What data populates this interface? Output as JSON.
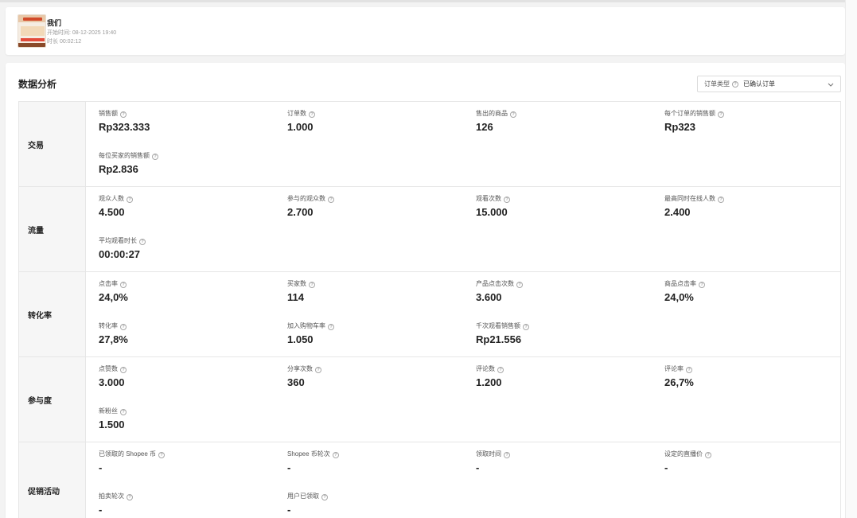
{
  "stream": {
    "title": "我们",
    "start_time": "开始时间: 08-12-2025 19:40",
    "duration": "时长 00:02:12"
  },
  "analysis": {
    "title": "数据分析",
    "order_type_label": "订单类型",
    "order_type_value": "已确认订单"
  },
  "sections": [
    {
      "name": "交易",
      "metrics": [
        {
          "label": "销售额",
          "value": "Rp323.333"
        },
        {
          "label": "订单数",
          "value": "1.000"
        },
        {
          "label": "售出的商品",
          "value": "126"
        },
        {
          "label": "每个订单的销售额",
          "value": "Rp323"
        },
        {
          "label": "每位买家的销售额",
          "value": "Rp2.836"
        }
      ]
    },
    {
      "name": "流量",
      "metrics": [
        {
          "label": "观众人数",
          "value": "4.500"
        },
        {
          "label": "参与的观众数",
          "value": "2.700"
        },
        {
          "label": "观看次数",
          "value": "15.000"
        },
        {
          "label": "最高同时在线人数",
          "value": "2.400"
        },
        {
          "label": "平均观看时长",
          "value": "00:00:27"
        }
      ]
    },
    {
      "name": "转化率",
      "metrics": [
        {
          "label": "点击率",
          "value": "24,0%"
        },
        {
          "label": "买家数",
          "value": "114"
        },
        {
          "label": "产品点击次数",
          "value": "3.600"
        },
        {
          "label": "商品点击率",
          "value": "24,0%"
        },
        {
          "label": "转化率",
          "value": "27,8%"
        },
        {
          "label": "加入购物车率",
          "value": "1.050"
        },
        {
          "label": "千次观看销售额",
          "value": "Rp21.556"
        }
      ]
    },
    {
      "name": "参与度",
      "metrics": [
        {
          "label": "点赞数",
          "value": "3.000"
        },
        {
          "label": "分享次数",
          "value": "360"
        },
        {
          "label": "评论数",
          "value": "1.200"
        },
        {
          "label": "评论率",
          "value": "26,7%"
        },
        {
          "label": "新粉丝",
          "value": "1.500"
        }
      ]
    },
    {
      "name": "促销活动",
      "metrics": [
        {
          "label": "已领取的 Shopee 币",
          "value": "-"
        },
        {
          "label": "Shopee 币轮次",
          "value": "-"
        },
        {
          "label": "领取时间",
          "value": "-"
        },
        {
          "label": "设定的直播价",
          "value": "-"
        },
        {
          "label": "拍卖轮次",
          "value": "-"
        },
        {
          "label": "用户已领取",
          "value": "-"
        }
      ]
    }
  ],
  "icons": {
    "help": "question-circle-icon",
    "dropdown": "chevron-down-icon"
  }
}
